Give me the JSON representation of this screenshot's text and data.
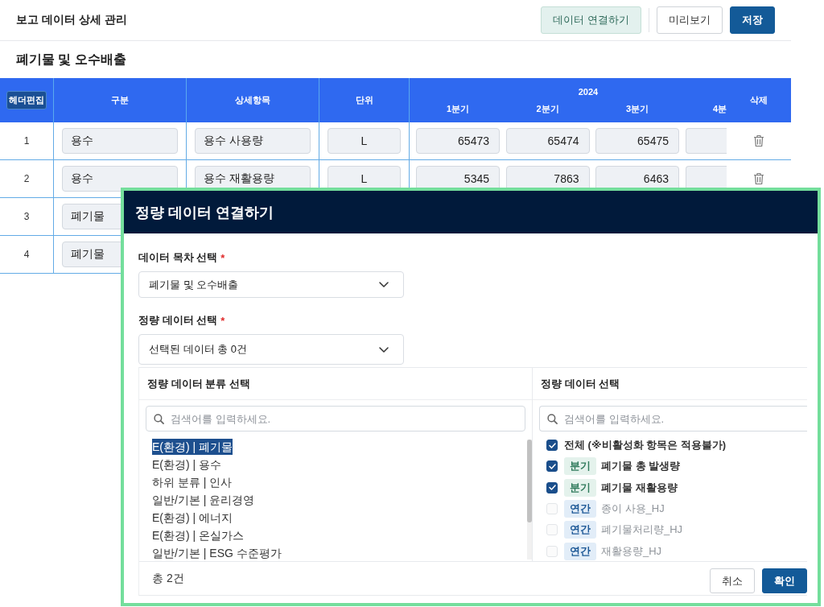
{
  "page": {
    "title": "보고 데이터 상세 관리",
    "buttons": [
      {
        "label": "데이터 연결하기",
        "kind": "soft"
      },
      {
        "label": "미리보기",
        "kind": "outline"
      },
      {
        "label": "저장",
        "kind": "primary"
      }
    ]
  },
  "section": {
    "title": "폐기물 및 오수배출"
  },
  "table": {
    "edit_header_button": "헤더편집",
    "columns": [
      "구분",
      "상세항목",
      "단위"
    ],
    "year": "2024",
    "quarters": [
      "1분기",
      "2분기",
      "3분기",
      "4분"
    ],
    "delete_column": "삭제",
    "rows": [
      {
        "number": "1",
        "category": "용수",
        "item": "용수 사용량",
        "unit": "L",
        "values": [
          "65473",
          "65474",
          "65475"
        ]
      },
      {
        "number": "2",
        "category": "용수",
        "item": "용수 재활용량",
        "unit": "L",
        "values": [
          "5345",
          "7863",
          "6463"
        ]
      },
      {
        "number": "3",
        "category": "폐기물"
      },
      {
        "number": "4",
        "category": "폐기물"
      }
    ]
  },
  "dialog": {
    "title": "정량 데이터 연결하기",
    "fields": [
      {
        "label": "데이터 목차 선택",
        "required_mark": "*",
        "value": "폐기물 및 오수배출"
      },
      {
        "label": "정량 데이터 선택",
        "required_mark": "*",
        "value": "선택된 데이터 총 0건"
      }
    ],
    "category_panel": {
      "title": "정량 데이터 분류 선택",
      "search": {
        "placeholder": "검색어를 입력하세요."
      },
      "items": [
        {
          "label": "E(환경) | 폐기물",
          "selected": true
        },
        {
          "label": "E(환경) | 용수",
          "selected": false
        },
        {
          "label": "하위 분류 | 인사",
          "selected": false
        },
        {
          "label": "일반/기본 | 윤리경영",
          "selected": false
        },
        {
          "label": "E(환경) | 에너지",
          "selected": false
        },
        {
          "label": "E(환경) | 온실가스",
          "selected": false
        },
        {
          "label": "일반/기본 | ESG 수준평가",
          "selected": false
        }
      ]
    },
    "data_panel": {
      "title": "정량 데이터 선택",
      "search": {
        "placeholder": "검색어를 입력하세요."
      },
      "items": [
        {
          "label": "전체 (※비활성화 항목은 적용불가)",
          "checked": true,
          "disabled": false
        },
        {
          "badge": {
            "label": "분기",
            "kind": "quarterly"
          },
          "label": "폐기물 총 발생량",
          "checked": true,
          "disabled": false
        },
        {
          "badge": {
            "label": "분기",
            "kind": "quarterly"
          },
          "label": "폐기물 재활용량",
          "checked": true,
          "disabled": false
        },
        {
          "badge": {
            "label": "연간",
            "kind": "annual"
          },
          "label": "종이 사용_HJ",
          "checked": false,
          "disabled": true
        },
        {
          "badge": {
            "label": "연간",
            "kind": "annual"
          },
          "label": "폐기물처리량_HJ",
          "checked": false,
          "disabled": true
        },
        {
          "badge": {
            "label": "연간",
            "kind": "annual"
          },
          "label": "재활용량_HJ",
          "checked": false,
          "disabled": true
        }
      ]
    },
    "footer": {
      "count": "총 2건",
      "buttons": [
        {
          "label": "취소",
          "kind": "outline"
        },
        {
          "label": "확인",
          "kind": "primary"
        }
      ]
    }
  }
}
